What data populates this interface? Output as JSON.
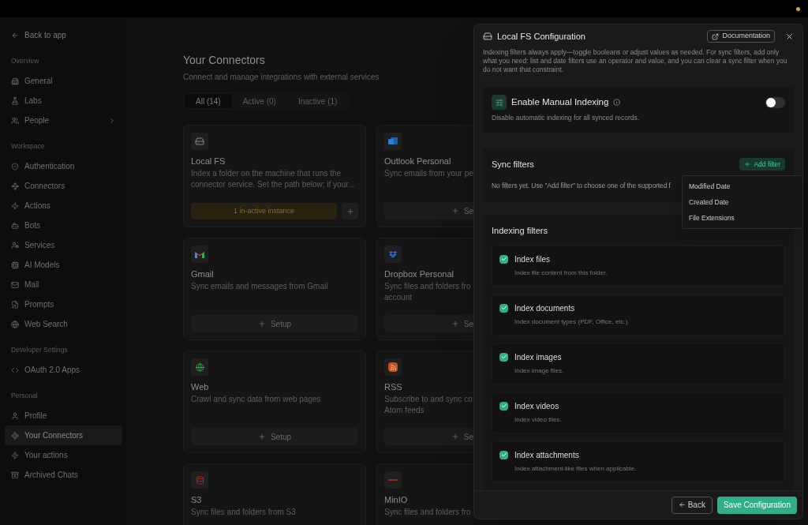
{
  "sidebar": {
    "back_link": "Back to app",
    "sections": [
      {
        "title": "Overview",
        "items": [
          {
            "label": "General",
            "selected": false,
            "has_submenu": false
          },
          {
            "label": "Labs",
            "selected": false,
            "has_submenu": false
          },
          {
            "label": "People",
            "selected": false,
            "has_submenu": true
          }
        ]
      },
      {
        "title": "Workspace",
        "items": [
          {
            "label": "Authentication",
            "selected": false,
            "has_submenu": false
          },
          {
            "label": "Connectors",
            "selected": false,
            "has_submenu": false
          },
          {
            "label": "Actions",
            "selected": false,
            "has_submenu": false
          },
          {
            "label": "Bots",
            "selected": false,
            "has_submenu": false
          },
          {
            "label": "Services",
            "selected": false,
            "has_submenu": false
          },
          {
            "label": "AI Models",
            "selected": false,
            "has_submenu": false
          },
          {
            "label": "Mail",
            "selected": false,
            "has_submenu": false
          },
          {
            "label": "Prompts",
            "selected": false,
            "has_submenu": false
          },
          {
            "label": "Web Search",
            "selected": false,
            "has_submenu": false
          }
        ]
      },
      {
        "title": "Developer Settings",
        "items": [
          {
            "label": "OAuth 2.0 Apps",
            "selected": false,
            "has_submenu": false
          }
        ]
      },
      {
        "title": "Personal",
        "items": [
          {
            "label": "Profile",
            "selected": false,
            "has_submenu": false
          },
          {
            "label": "Your Connectors",
            "selected": true,
            "has_submenu": false
          },
          {
            "label": "Your actions",
            "selected": false,
            "has_submenu": false
          },
          {
            "label": "Archived Chats",
            "selected": false,
            "has_submenu": false
          }
        ]
      }
    ]
  },
  "page": {
    "title": "Your Connectors",
    "subtitle": "Connect and manage integrations with external services",
    "tabs": [
      {
        "label": "All (14)",
        "selected": true
      },
      {
        "label": "Active (0)",
        "selected": false
      },
      {
        "label": "Inactive (1)",
        "selected": false
      }
    ],
    "cards": [
      {
        "name": "Local FS",
        "description_lines": [
          "Index a folder on the machine that runs the",
          "connector service. Set the path below; if your..."
        ],
        "action": {
          "kind": "instances",
          "label": "1 in-active instance"
        }
      },
      {
        "name": "Outlook Personal",
        "description_lines": [
          "Sync emails from your pe"
        ],
        "action": {
          "kind": "setup",
          "label": "Se"
        }
      },
      {
        "name": "Gmail",
        "description_lines": [
          "Sync emails and messages from Gmail"
        ],
        "action": {
          "kind": "setup",
          "label": "Setup"
        }
      },
      {
        "name": "Dropbox Personal",
        "description_lines": [
          "Sync files and folders fro",
          "account"
        ],
        "action": {
          "kind": "setup",
          "label": "Se"
        }
      },
      {
        "name": "Web",
        "description_lines": [
          "Crawl and sync data from web pages"
        ],
        "action": {
          "kind": "setup",
          "label": "Setup"
        }
      },
      {
        "name": "RSS",
        "description_lines": [
          "Subscribe to and sync co",
          "Atom feeds"
        ],
        "action": {
          "kind": "setup",
          "label": "Se"
        }
      },
      {
        "name": "S3",
        "description_lines": [
          "Sync files and folders from S3"
        ]
      },
      {
        "name": "MinIO",
        "description_lines": [
          "Sync files and folders fro"
        ]
      }
    ]
  },
  "dialog": {
    "title": "Local FS Configuration",
    "documentation_label": "Documentation",
    "description": "Indexing filters always apply—toggle booleans or adjust values as needed. For sync filters, add only what you need: list and date filters use an operator and value, and you can clear a sync filter when you do not want that constraint.",
    "manual_indexing": {
      "title": "Enable Manual Indexing",
      "description": "Disable automatic indexing for all synced records.",
      "on": false
    },
    "sync_filters": {
      "title": "Sync filters",
      "add_label": "Add filter",
      "empty_text": "No filters yet. Use \"Add filter\" to choose one of the supported f",
      "menu": [
        "Modified Date",
        "Created Date",
        "File Extensions"
      ]
    },
    "indexing_filters": {
      "title": "Indexing filters",
      "items": [
        {
          "label": "Index files",
          "description": "Index file content from this folder.",
          "checked": true
        },
        {
          "label": "Index documents",
          "description": "Index document types (PDF, Office, etc.).",
          "checked": true
        },
        {
          "label": "Index images",
          "description": "Index image files.",
          "checked": true
        },
        {
          "label": "Index videos",
          "description": "Index video files.",
          "checked": true
        },
        {
          "label": "Index attachments",
          "description": "Index attachment-like files when applicable.",
          "checked": true
        }
      ]
    },
    "back_label": "Back",
    "save_label": "Save Configuration"
  }
}
